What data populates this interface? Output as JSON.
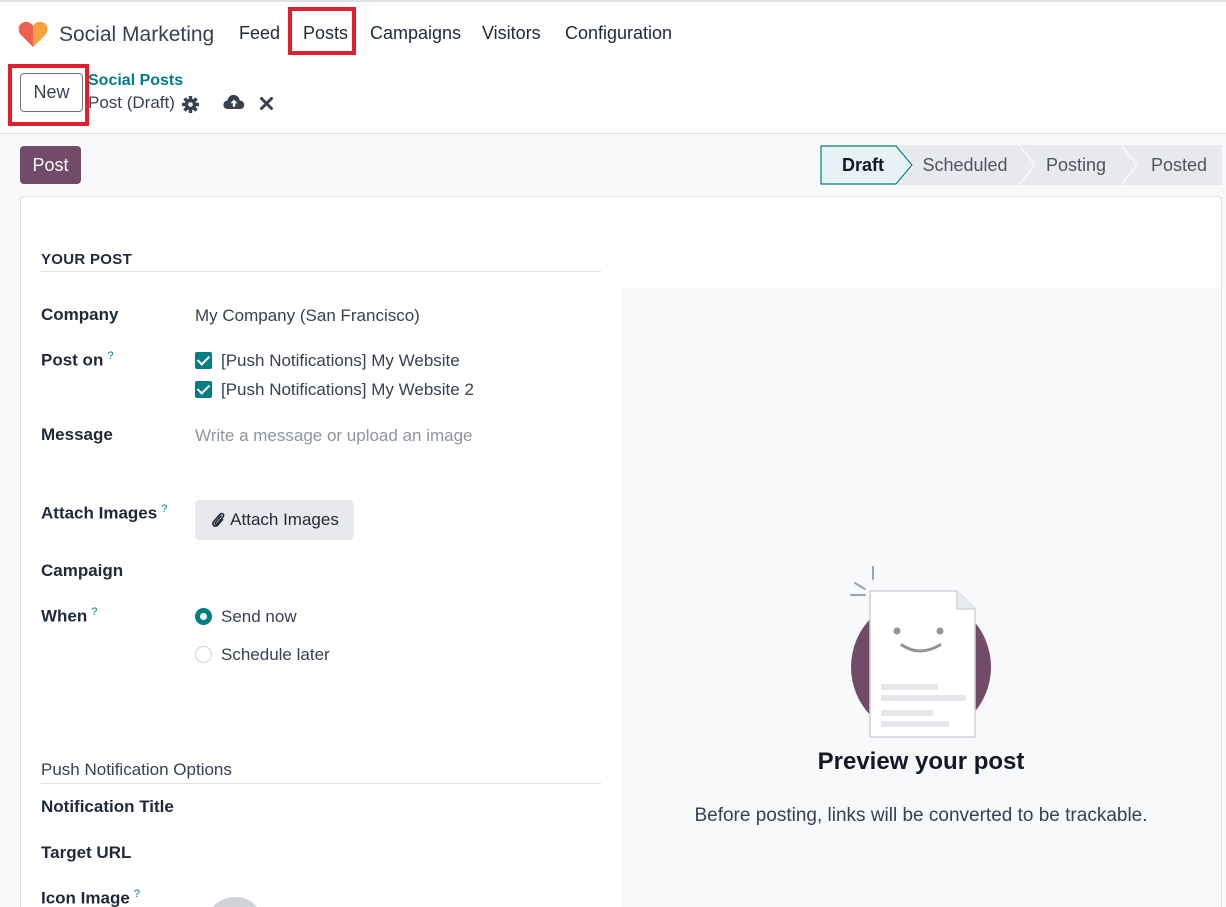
{
  "app": {
    "name": "Social Marketing",
    "logo_icon": "heart-logo-icon"
  },
  "nav": {
    "items": [
      {
        "label": "Feed"
      },
      {
        "label": "Posts"
      },
      {
        "label": "Campaigns"
      },
      {
        "label": "Visitors"
      },
      {
        "label": "Configuration"
      }
    ]
  },
  "control_panel": {
    "new_label": "New",
    "breadcrumb_parent": "Social Posts",
    "breadcrumb_current": "Post (Draft)",
    "icons": [
      "gear-icon",
      "cloud-upload-icon",
      "close-icon"
    ]
  },
  "actions": {
    "post_label": "Post"
  },
  "statusbar": {
    "stages": [
      "Draft",
      "Scheduled",
      "Posting",
      "Posted"
    ],
    "active": "Draft"
  },
  "form": {
    "section_title": "YOUR POST",
    "company_label": "Company",
    "company_value": "My Company (San Francisco)",
    "post_on_label": "Post on",
    "help_mark": "?",
    "accounts": [
      {
        "label": "[Push Notifications] My Website",
        "checked": true
      },
      {
        "label": "[Push Notifications] My Website 2",
        "checked": true
      }
    ],
    "message_label": "Message",
    "message_placeholder": "Write a message or upload an image",
    "attach_label": "Attach Images",
    "attach_button": "Attach Images",
    "campaign_label": "Campaign",
    "when_label": "When",
    "when_options": [
      {
        "label": "Send now",
        "selected": true
      },
      {
        "label": "Schedule later",
        "selected": false
      }
    ],
    "push_section": "Push Notification Options",
    "notification_title_label": "Notification Title",
    "target_url_label": "Target URL",
    "icon_image_label": "Icon Image"
  },
  "preview": {
    "title": "Preview your post",
    "description": "Before posting, links will be converted to be trackable."
  },
  "colors": {
    "brand_purple": "#714b67",
    "teal": "#017e84",
    "highlight_red": "#e0202e"
  }
}
